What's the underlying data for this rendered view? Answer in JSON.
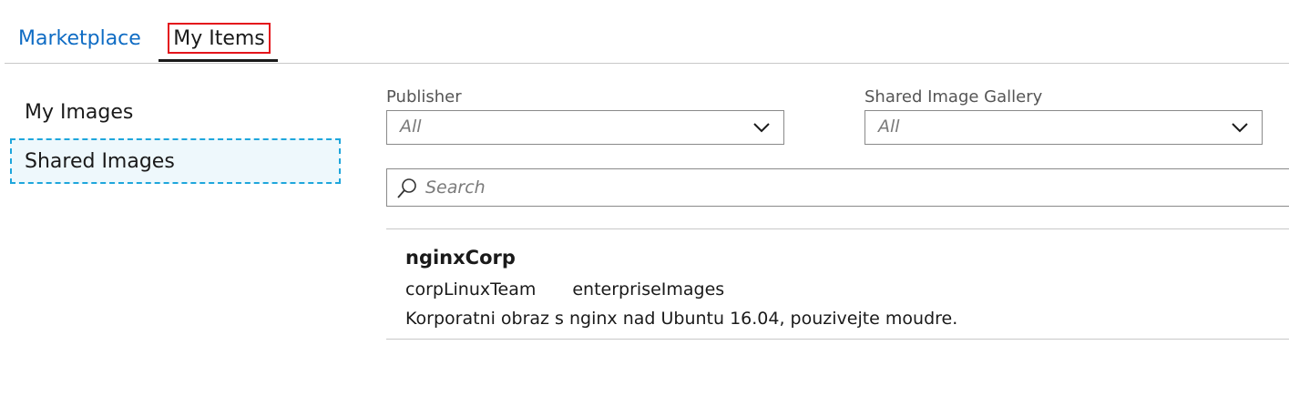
{
  "tabs": {
    "marketplace": "Marketplace",
    "my_items": "My Items",
    "active": "My Items"
  },
  "sidebar": {
    "items": [
      {
        "label": "My Images"
      },
      {
        "label": "Shared Images",
        "selected": true
      }
    ]
  },
  "filters": {
    "publisher": {
      "label": "Publisher",
      "value": "All"
    },
    "gallery": {
      "label": "Shared Image Gallery",
      "value": "All"
    }
  },
  "search": {
    "placeholder": "Search"
  },
  "results": [
    {
      "name": "nginxCorp",
      "publisher": "corpLinuxTeam",
      "gallery": "enterpriseImages",
      "description": "Korporatni obraz s nginx nad Ubuntu 16.04, pouzivejte moudre."
    }
  ],
  "colors": {
    "link": "#0f6cc4",
    "highlight_box": "#e4141b",
    "selection_border": "#1ea6dc",
    "selection_bg": "#eef8fc"
  },
  "icons": {
    "search": "search-icon",
    "dropdown": "chevron-down-icon"
  }
}
